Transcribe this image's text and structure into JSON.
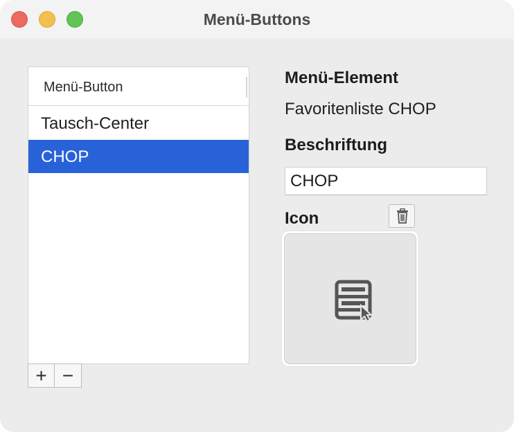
{
  "window": {
    "title": "Menü-Buttons"
  },
  "list": {
    "column_header": "Menü-Button",
    "rows": [
      {
        "label": "Tausch-Center",
        "selected": false
      },
      {
        "label": "CHOP",
        "selected": true
      }
    ],
    "add_label": "+",
    "remove_label": "−"
  },
  "detail": {
    "menu_element_label": "Menü-Element",
    "menu_element_value": "Favoritenliste CHOP",
    "caption_label": "Beschriftung",
    "caption_value": "CHOP",
    "icon_label": "Icon",
    "icon_name": "menu-list-cursor-icon"
  },
  "colors": {
    "selection": "#2862d9",
    "window_bg": "#ececec",
    "close": "#ec6a5f",
    "minimize": "#f5bf4f",
    "zoom": "#61c454"
  }
}
